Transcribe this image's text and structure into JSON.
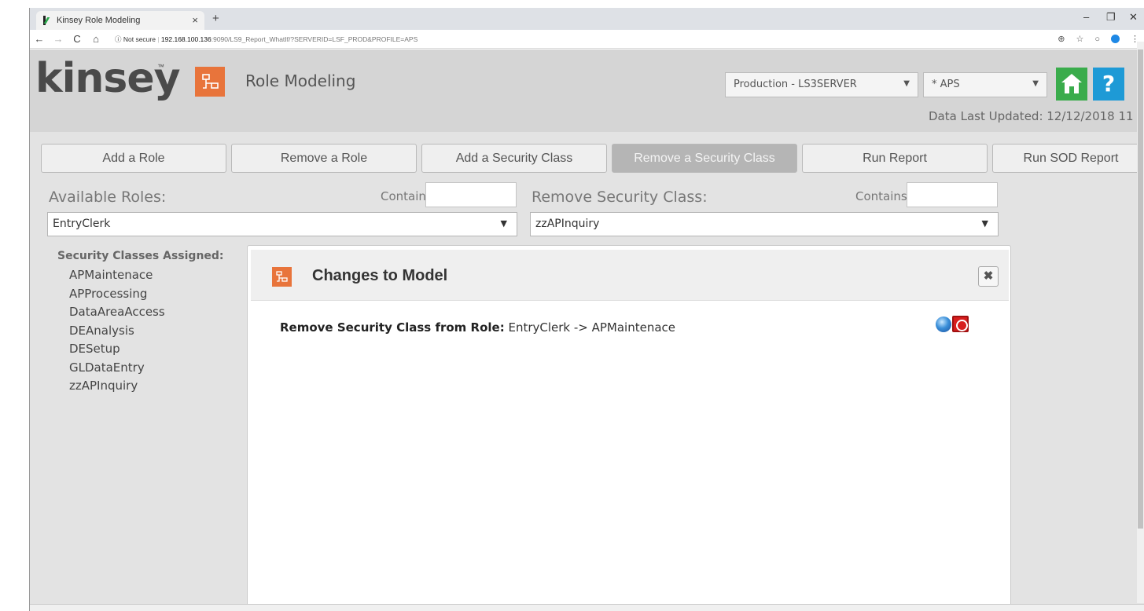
{
  "browser": {
    "tab_title": "Kinsey Role Modeling",
    "tab_close": "×",
    "new_tab": "+",
    "minimize": "–",
    "restore": "❐",
    "close": "✕",
    "address": {
      "security": "ⓘ Not secure",
      "host": "192.168.100.136",
      "path": ":9090/LS9_Report_WhatIf/?SERVERID=LSF_PROD&PROFILE=APS"
    },
    "nav": {
      "back": "←",
      "forward": "→",
      "reload": "C",
      "home": "⌂"
    }
  },
  "app": {
    "logo_text": "kinsey",
    "logo_tm": "™",
    "module_title": "Role Modeling",
    "server_select": "Production - LS3SERVER",
    "profile_select": "* APS",
    "help_label": "?",
    "data_updated": "Data Last Updated: 12/12/2018 11",
    "colors": {
      "accent_orange": "#e8743b",
      "home_green": "#3aac4c",
      "help_blue": "#1e9ad6"
    }
  },
  "toolbar": [
    {
      "label": "Add a Role",
      "active": false
    },
    {
      "label": "Remove a Role",
      "active": false
    },
    {
      "label": "Add a Security Class",
      "active": false
    },
    {
      "label": "Remove a Security Class",
      "active": true
    },
    {
      "label": "Run Report",
      "active": false
    },
    {
      "label": "Run SOD Report",
      "active": false
    }
  ],
  "filters": {
    "available_roles_label": "Available Roles:",
    "remove_class_label": "Remove Security Class:",
    "contains_label": "Contains:",
    "roles_value": "EntryClerk",
    "class_value": "zzAPInquiry"
  },
  "assigned": {
    "heading": "Security Classes Assigned:",
    "items": [
      "APMaintenace",
      "APProcessing",
      "DataAreaAccess",
      "DEAnalysis",
      "DESetup",
      "GLDataEntry",
      "zzAPInquiry"
    ]
  },
  "modal": {
    "title": "Changes to Model",
    "close": "✖",
    "change_prefix": "Remove Security Class from Role:",
    "change_detail": " EntryClerk -> APMaintenace"
  }
}
